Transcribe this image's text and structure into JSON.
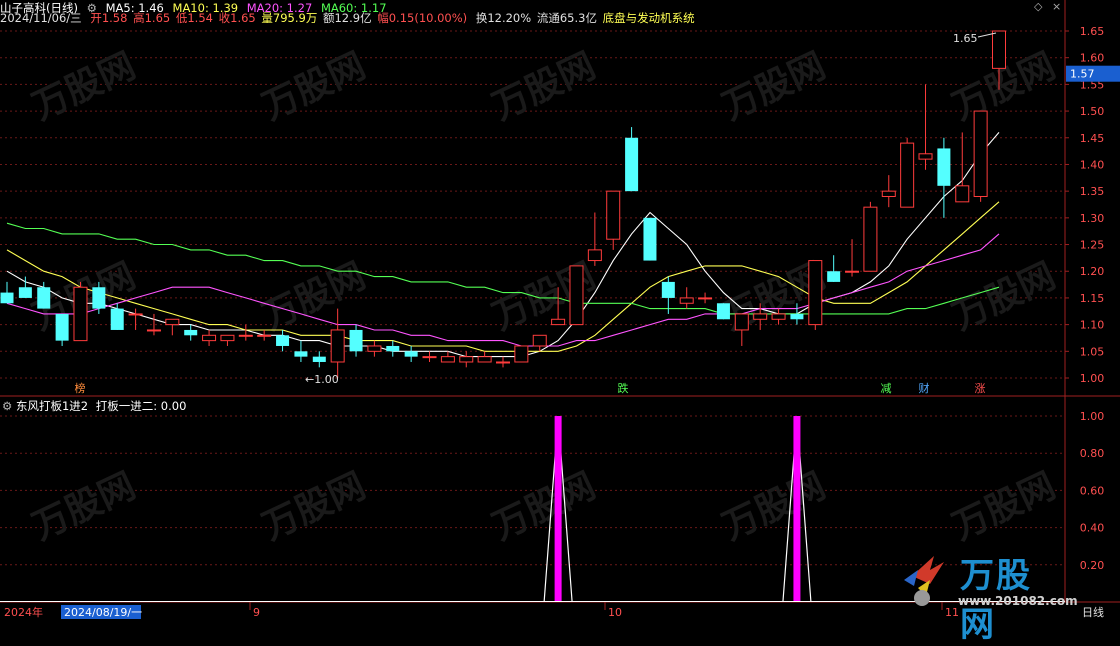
{
  "header": {
    "stock_name": "山子高科(日线)",
    "ma5": "MA5: 1.46",
    "ma10": "MA10: 1.39",
    "ma20": "MA20: 1.27",
    "ma60": "MA60: 1.17",
    "date": "2024/11/06/三",
    "open": "开1.58",
    "high": "高1.65",
    "low": "低1.54",
    "close": "收1.65",
    "volume": "量795.9万",
    "amount": "额12.9亿",
    "change": "幅0.15(10.00%)",
    "turnover": "换12.20%",
    "float_cap": "流通65.3亿",
    "system": "底盘与发动机系统"
  },
  "indicator": {
    "title": "东风打板1进2",
    "value_label": "打板一进二: 0.00"
  },
  "price_axis": {
    "ticks": [
      "1.65",
      "1.60",
      "1.55",
      "1.50",
      "1.45",
      "1.40",
      "1.35",
      "1.30",
      "1.25",
      "1.20",
      "1.15",
      "1.10",
      "1.05",
      "1.00"
    ],
    "current": "1.57"
  },
  "indicator_axis": {
    "ticks": [
      "1.00",
      "0.80",
      "0.60",
      "0.40",
      "0.20"
    ]
  },
  "annotations": {
    "high_label": "1.65",
    "low_label": "1.00",
    "markers": [
      "榜",
      "跌",
      "减",
      "财",
      "涨"
    ]
  },
  "time_axis": {
    "year": "2024年",
    "cursor_date": "2024/08/19/一",
    "months": [
      "9",
      "10",
      "11"
    ],
    "period": "日线"
  },
  "watermark": {
    "brand": "万股网",
    "url": "www.201082.com"
  },
  "colors": {
    "up": "#ff3c3c",
    "down": "#54ffff",
    "ma5": "#ffffff",
    "ma10": "#ffff54",
    "ma20": "#ff54ff",
    "ma60": "#54ff54",
    "signal": "#ff00ff"
  },
  "chart_data": {
    "type": "candlestick",
    "series": [
      {
        "name": "K",
        "ohlc": [
          [
            1.16,
            1.18,
            1.14,
            1.14
          ],
          [
            1.17,
            1.19,
            1.15,
            1.15
          ],
          [
            1.17,
            1.18,
            1.13,
            1.13
          ],
          [
            1.12,
            1.12,
            1.06,
            1.07
          ],
          [
            1.07,
            1.18,
            1.07,
            1.17
          ],
          [
            1.17,
            1.18,
            1.12,
            1.13
          ],
          [
            1.13,
            1.14,
            1.09,
            1.09
          ],
          [
            1.12,
            1.13,
            1.09,
            1.12
          ],
          [
            1.09,
            1.12,
            1.08,
            1.09
          ],
          [
            1.1,
            1.11,
            1.08,
            1.11
          ],
          [
            1.09,
            1.1,
            1.07,
            1.08
          ],
          [
            1.07,
            1.09,
            1.06,
            1.08
          ],
          [
            1.07,
            1.08,
            1.06,
            1.08
          ],
          [
            1.08,
            1.1,
            1.07,
            1.08
          ],
          [
            1.08,
            1.09,
            1.07,
            1.08
          ],
          [
            1.08,
            1.09,
            1.05,
            1.06
          ],
          [
            1.05,
            1.07,
            1.03,
            1.04
          ],
          [
            1.04,
            1.05,
            1.02,
            1.03
          ],
          [
            1.03,
            1.13,
            1.0,
            1.09
          ],
          [
            1.09,
            1.1,
            1.04,
            1.05
          ],
          [
            1.05,
            1.07,
            1.04,
            1.06
          ],
          [
            1.06,
            1.07,
            1.04,
            1.05
          ],
          [
            1.05,
            1.06,
            1.03,
            1.04
          ],
          [
            1.04,
            1.05,
            1.03,
            1.04
          ],
          [
            1.03,
            1.05,
            1.03,
            1.04
          ],
          [
            1.03,
            1.05,
            1.02,
            1.04
          ],
          [
            1.03,
            1.05,
            1.03,
            1.04
          ],
          [
            1.03,
            1.04,
            1.02,
            1.03
          ],
          [
            1.03,
            1.06,
            1.03,
            1.06
          ],
          [
            1.06,
            1.08,
            1.05,
            1.08
          ],
          [
            1.1,
            1.17,
            1.1,
            1.11
          ],
          [
            1.1,
            1.21,
            1.1,
            1.21
          ],
          [
            1.22,
            1.31,
            1.21,
            1.24
          ],
          [
            1.26,
            1.35,
            1.24,
            1.35
          ],
          [
            1.45,
            1.47,
            1.35,
            1.35
          ],
          [
            1.3,
            1.3,
            1.22,
            1.22
          ],
          [
            1.18,
            1.19,
            1.12,
            1.15
          ],
          [
            1.14,
            1.17,
            1.13,
            1.15
          ],
          [
            1.15,
            1.16,
            1.14,
            1.15
          ],
          [
            1.14,
            1.14,
            1.11,
            1.11
          ],
          [
            1.09,
            1.12,
            1.06,
            1.12
          ],
          [
            1.11,
            1.14,
            1.09,
            1.12
          ],
          [
            1.11,
            1.13,
            1.1,
            1.12
          ],
          [
            1.12,
            1.14,
            1.1,
            1.11
          ],
          [
            1.1,
            1.22,
            1.09,
            1.22
          ],
          [
            1.2,
            1.23,
            1.18,
            1.18
          ],
          [
            1.2,
            1.26,
            1.19,
            1.2
          ],
          [
            1.2,
            1.33,
            1.2,
            1.32
          ],
          [
            1.34,
            1.38,
            1.32,
            1.35
          ],
          [
            1.32,
            1.45,
            1.32,
            1.44
          ],
          [
            1.41,
            1.55,
            1.39,
            1.42
          ],
          [
            1.43,
            1.45,
            1.3,
            1.36
          ],
          [
            1.33,
            1.46,
            1.33,
            1.36
          ],
          [
            1.34,
            1.5,
            1.33,
            1.5
          ],
          [
            1.58,
            1.65,
            1.54,
            1.65
          ]
        ]
      },
      {
        "name": "MA5",
        "values": [
          1.2,
          1.18,
          1.17,
          1.15,
          1.14,
          1.14,
          1.13,
          1.12,
          1.11,
          1.1,
          1.1,
          1.09,
          1.09,
          1.09,
          1.08,
          1.08,
          1.07,
          1.07,
          1.06,
          1.06,
          1.06,
          1.05,
          1.05,
          1.05,
          1.05,
          1.04,
          1.04,
          1.04,
          1.04,
          1.05,
          1.07,
          1.11,
          1.16,
          1.22,
          1.27,
          1.31,
          1.28,
          1.25,
          1.2,
          1.16,
          1.13,
          1.13,
          1.12,
          1.12,
          1.14,
          1.15,
          1.16,
          1.18,
          1.21,
          1.26,
          1.3,
          1.34,
          1.37,
          1.42,
          1.46
        ]
      },
      {
        "name": "MA10",
        "values": [
          1.24,
          1.22,
          1.2,
          1.19,
          1.17,
          1.16,
          1.15,
          1.14,
          1.13,
          1.12,
          1.11,
          1.1,
          1.1,
          1.09,
          1.09,
          1.09,
          1.08,
          1.08,
          1.08,
          1.07,
          1.07,
          1.07,
          1.06,
          1.06,
          1.06,
          1.06,
          1.05,
          1.05,
          1.05,
          1.05,
          1.05,
          1.06,
          1.08,
          1.11,
          1.14,
          1.17,
          1.19,
          1.2,
          1.21,
          1.21,
          1.21,
          1.2,
          1.19,
          1.17,
          1.15,
          1.14,
          1.14,
          1.14,
          1.16,
          1.18,
          1.21,
          1.24,
          1.27,
          1.3,
          1.33
        ]
      },
      {
        "name": "MA20",
        "values": [
          1.14,
          1.13,
          1.12,
          1.12,
          1.12,
          1.13,
          1.14,
          1.15,
          1.16,
          1.17,
          1.17,
          1.17,
          1.16,
          1.15,
          1.14,
          1.13,
          1.12,
          1.11,
          1.1,
          1.1,
          1.09,
          1.09,
          1.08,
          1.08,
          1.07,
          1.07,
          1.07,
          1.07,
          1.06,
          1.06,
          1.06,
          1.07,
          1.07,
          1.08,
          1.09,
          1.1,
          1.11,
          1.11,
          1.12,
          1.12,
          1.12,
          1.13,
          1.13,
          1.13,
          1.14,
          1.15,
          1.16,
          1.17,
          1.18,
          1.2,
          1.21,
          1.22,
          1.23,
          1.24,
          1.27
        ]
      },
      {
        "name": "MA60",
        "values": [
          1.29,
          1.28,
          1.28,
          1.27,
          1.27,
          1.27,
          1.26,
          1.26,
          1.25,
          1.25,
          1.24,
          1.24,
          1.23,
          1.23,
          1.22,
          1.22,
          1.21,
          1.21,
          1.2,
          1.2,
          1.19,
          1.19,
          1.18,
          1.18,
          1.18,
          1.17,
          1.17,
          1.16,
          1.16,
          1.15,
          1.15,
          1.14,
          1.14,
          1.14,
          1.14,
          1.13,
          1.13,
          1.13,
          1.13,
          1.12,
          1.12,
          1.12,
          1.12,
          1.12,
          1.12,
          1.12,
          1.12,
          1.12,
          1.12,
          1.13,
          1.13,
          1.14,
          1.15,
          1.16,
          1.17
        ]
      },
      {
        "name": "打板一进二",
        "values": [
          0,
          0,
          0,
          0,
          0,
          0,
          0,
          0,
          0,
          0,
          0,
          0,
          0,
          0,
          0,
          0,
          0,
          0,
          0,
          0,
          0,
          0,
          0,
          0,
          0,
          0,
          0,
          0,
          0,
          0,
          1,
          0,
          0,
          0,
          0,
          0,
          0,
          0,
          0,
          0,
          0,
          0,
          0,
          1,
          0,
          0,
          0,
          0,
          0,
          0,
          0,
          0,
          0,
          0,
          0
        ]
      }
    ],
    "ylim": [
      0.97,
      1.68
    ],
    "indicator_ylim": [
      0,
      1.05
    ]
  }
}
